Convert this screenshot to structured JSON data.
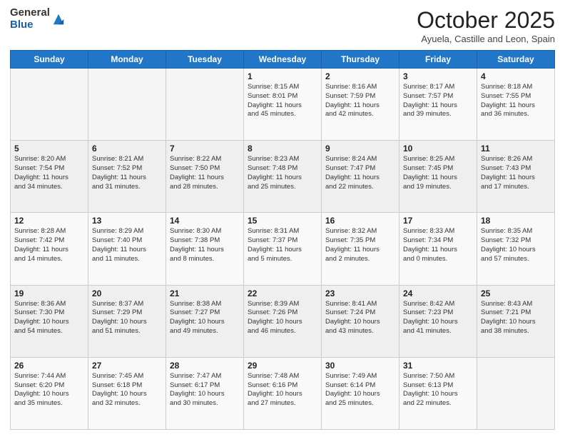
{
  "header": {
    "logo_general": "General",
    "logo_blue": "Blue",
    "month_title": "October 2025",
    "location": "Ayuela, Castille and Leon, Spain"
  },
  "days_of_week": [
    "Sunday",
    "Monday",
    "Tuesday",
    "Wednesday",
    "Thursday",
    "Friday",
    "Saturday"
  ],
  "weeks": [
    [
      {
        "day": "",
        "info": ""
      },
      {
        "day": "",
        "info": ""
      },
      {
        "day": "",
        "info": ""
      },
      {
        "day": "1",
        "info": "Sunrise: 8:15 AM\nSunset: 8:01 PM\nDaylight: 11 hours\nand 45 minutes."
      },
      {
        "day": "2",
        "info": "Sunrise: 8:16 AM\nSunset: 7:59 PM\nDaylight: 11 hours\nand 42 minutes."
      },
      {
        "day": "3",
        "info": "Sunrise: 8:17 AM\nSunset: 7:57 PM\nDaylight: 11 hours\nand 39 minutes."
      },
      {
        "day": "4",
        "info": "Sunrise: 8:18 AM\nSunset: 7:55 PM\nDaylight: 11 hours\nand 36 minutes."
      }
    ],
    [
      {
        "day": "5",
        "info": "Sunrise: 8:20 AM\nSunset: 7:54 PM\nDaylight: 11 hours\nand 34 minutes."
      },
      {
        "day": "6",
        "info": "Sunrise: 8:21 AM\nSunset: 7:52 PM\nDaylight: 11 hours\nand 31 minutes."
      },
      {
        "day": "7",
        "info": "Sunrise: 8:22 AM\nSunset: 7:50 PM\nDaylight: 11 hours\nand 28 minutes."
      },
      {
        "day": "8",
        "info": "Sunrise: 8:23 AM\nSunset: 7:48 PM\nDaylight: 11 hours\nand 25 minutes."
      },
      {
        "day": "9",
        "info": "Sunrise: 8:24 AM\nSunset: 7:47 PM\nDaylight: 11 hours\nand 22 minutes."
      },
      {
        "day": "10",
        "info": "Sunrise: 8:25 AM\nSunset: 7:45 PM\nDaylight: 11 hours\nand 19 minutes."
      },
      {
        "day": "11",
        "info": "Sunrise: 8:26 AM\nSunset: 7:43 PM\nDaylight: 11 hours\nand 17 minutes."
      }
    ],
    [
      {
        "day": "12",
        "info": "Sunrise: 8:28 AM\nSunset: 7:42 PM\nDaylight: 11 hours\nand 14 minutes."
      },
      {
        "day": "13",
        "info": "Sunrise: 8:29 AM\nSunset: 7:40 PM\nDaylight: 11 hours\nand 11 minutes."
      },
      {
        "day": "14",
        "info": "Sunrise: 8:30 AM\nSunset: 7:38 PM\nDaylight: 11 hours\nand 8 minutes."
      },
      {
        "day": "15",
        "info": "Sunrise: 8:31 AM\nSunset: 7:37 PM\nDaylight: 11 hours\nand 5 minutes."
      },
      {
        "day": "16",
        "info": "Sunrise: 8:32 AM\nSunset: 7:35 PM\nDaylight: 11 hours\nand 2 minutes."
      },
      {
        "day": "17",
        "info": "Sunrise: 8:33 AM\nSunset: 7:34 PM\nDaylight: 11 hours\nand 0 minutes."
      },
      {
        "day": "18",
        "info": "Sunrise: 8:35 AM\nSunset: 7:32 PM\nDaylight: 10 hours\nand 57 minutes."
      }
    ],
    [
      {
        "day": "19",
        "info": "Sunrise: 8:36 AM\nSunset: 7:30 PM\nDaylight: 10 hours\nand 54 minutes."
      },
      {
        "day": "20",
        "info": "Sunrise: 8:37 AM\nSunset: 7:29 PM\nDaylight: 10 hours\nand 51 minutes."
      },
      {
        "day": "21",
        "info": "Sunrise: 8:38 AM\nSunset: 7:27 PM\nDaylight: 10 hours\nand 49 minutes."
      },
      {
        "day": "22",
        "info": "Sunrise: 8:39 AM\nSunset: 7:26 PM\nDaylight: 10 hours\nand 46 minutes."
      },
      {
        "day": "23",
        "info": "Sunrise: 8:41 AM\nSunset: 7:24 PM\nDaylight: 10 hours\nand 43 minutes."
      },
      {
        "day": "24",
        "info": "Sunrise: 8:42 AM\nSunset: 7:23 PM\nDaylight: 10 hours\nand 41 minutes."
      },
      {
        "day": "25",
        "info": "Sunrise: 8:43 AM\nSunset: 7:21 PM\nDaylight: 10 hours\nand 38 minutes."
      }
    ],
    [
      {
        "day": "26",
        "info": "Sunrise: 7:44 AM\nSunset: 6:20 PM\nDaylight: 10 hours\nand 35 minutes."
      },
      {
        "day": "27",
        "info": "Sunrise: 7:45 AM\nSunset: 6:18 PM\nDaylight: 10 hours\nand 32 minutes."
      },
      {
        "day": "28",
        "info": "Sunrise: 7:47 AM\nSunset: 6:17 PM\nDaylight: 10 hours\nand 30 minutes."
      },
      {
        "day": "29",
        "info": "Sunrise: 7:48 AM\nSunset: 6:16 PM\nDaylight: 10 hours\nand 27 minutes."
      },
      {
        "day": "30",
        "info": "Sunrise: 7:49 AM\nSunset: 6:14 PM\nDaylight: 10 hours\nand 25 minutes."
      },
      {
        "day": "31",
        "info": "Sunrise: 7:50 AM\nSunset: 6:13 PM\nDaylight: 10 hours\nand 22 minutes."
      },
      {
        "day": "",
        "info": ""
      }
    ]
  ]
}
